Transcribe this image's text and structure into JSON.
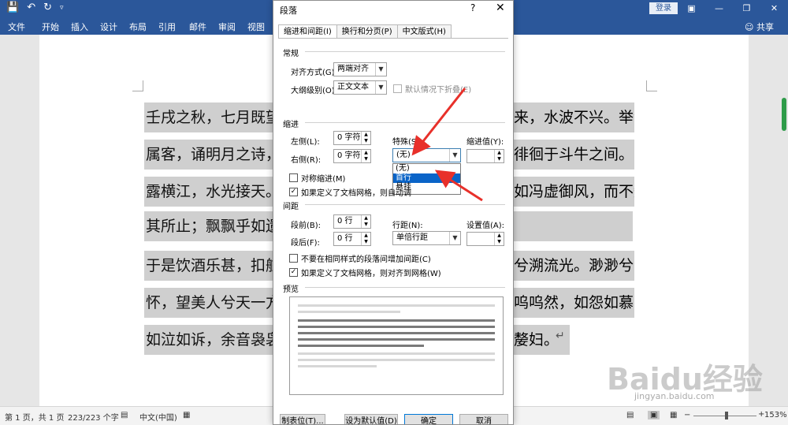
{
  "titlebar": {
    "login": "登录"
  },
  "ribbon": {
    "tabs": [
      "文件",
      "开始",
      "插入",
      "设计",
      "布局",
      "引用",
      "邮件",
      "审阅",
      "视图"
    ],
    "share": "共享"
  },
  "document": {
    "lines": [
      "壬戌之秋，七月既望，",
      "属客，诵明月之诗，歌",
      "露横江，水光接天。纵",
      "其所止；飘飘乎如遗世",
      "于是饮酒乐甚，扣舷而",
      "怀，望美人兮天一方。",
      "如泣如诉，余音袅袅"
    ],
    "right_fragments": [
      "来，水波不兴。举酒",
      "徘徊于斗牛之间。白",
      "如冯虚御风，而不知",
      "",
      "兮溯流光。渺渺兮予",
      "呜呜然，如怨如慕，",
      "嫠妇。"
    ]
  },
  "dialog": {
    "title": "段落",
    "help": "?",
    "close": "✕",
    "tabs": [
      "缩进和间距(I)",
      "换行和分页(P)",
      "中文版式(H)"
    ],
    "general": {
      "section": "常规",
      "alignment_label": "对齐方式(G):",
      "alignment_value": "两端对齐",
      "outline_label": "大纲级别(O):",
      "outline_value": "正文文本",
      "collapse_label": "默认情况下折叠(E)"
    },
    "indent": {
      "section": "缩进",
      "left_label": "左侧(L):",
      "left_value": "0 字符",
      "right_label": "右侧(R):",
      "right_value": "0 字符",
      "special_label": "特殊(S):",
      "special_value": "(无)",
      "by_label": "缩进值(Y):",
      "special_options": [
        "(无)",
        "首行",
        "悬挂"
      ],
      "mirror_label": "对称缩进(M)",
      "grid_label": "如果定义了文档网格，则自动调"
    },
    "spacing": {
      "section": "间距",
      "before_label": "段前(B):",
      "before_value": "0 行",
      "after_label": "段后(F):",
      "after_value": "0 行",
      "line_label": "行距(N):",
      "line_value": "单倍行距",
      "at_label": "设置值(A):",
      "no_space_label": "不要在相同样式的段落间增加间距(C)",
      "snap_label": "如果定义了文档网格，则对齐到网格(W)"
    },
    "preview": {
      "section": "预览"
    },
    "buttons": [
      "制表位(T)...",
      "设为默认值(D)",
      "确定",
      "取消"
    ]
  },
  "statusbar": {
    "page": "第 1 页，共 1 页",
    "words": "223/223 个字",
    "language": "中文(中国)",
    "zoom": "153%"
  },
  "watermark": {
    "text": "Baidu经验",
    "url": "jingyan.baidu.com"
  }
}
